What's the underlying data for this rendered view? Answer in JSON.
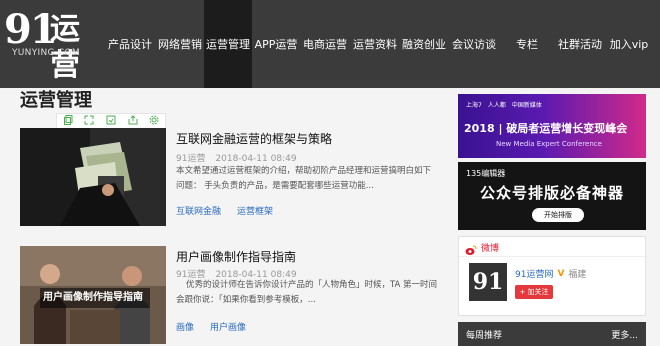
{
  "brand": {
    "number": "91",
    "cn": "运营",
    "en": "YUNYING.COM"
  },
  "nav": [
    {
      "label": "产品设计",
      "active": false
    },
    {
      "label": "网络营销",
      "active": false
    },
    {
      "label": "运营管理",
      "active": true
    },
    {
      "label": "APP运营",
      "active": false
    },
    {
      "label": "电商运营",
      "active": false
    },
    {
      "label": "运营资料",
      "active": false
    },
    {
      "label": "融资创业",
      "active": false
    },
    {
      "label": "会议访谈",
      "active": false
    },
    {
      "label": "专栏",
      "active": false
    },
    {
      "label": "社群活动",
      "active": false
    },
    {
      "label": "加入vip",
      "active": false
    }
  ],
  "page_title": "运营管理",
  "toolbar": {
    "icons": [
      "copy-icon",
      "fullscreen-icon",
      "save-icon",
      "share-icon",
      "settings-icon"
    ]
  },
  "articles": [
    {
      "title": "互联网金融运营的框架与策略",
      "source": "91运营",
      "date": "2018-04-11 08:49",
      "desc": "本文希望通过运营框架的介绍，帮助初阶产品经理和运营搞明白如下问题：   手头负责的产品，是需要配套哪些运营功能...",
      "tags": [
        "互联网金融",
        "运营框架"
      ]
    },
    {
      "title": "用户画像制作指导指南",
      "source": "91运营",
      "date": "2018-04-11 08:49",
      "desc": "优秀的设计师在告诉你设计产品的「人物角色」时候，TA 第一时间会跟你说：「如果你看到参考模板，...",
      "tags": [
        "画像",
        "用户画像"
      ],
      "thumb_caption": "用户画像制作指导指南"
    }
  ],
  "ad1": {
    "logos": [
      "上海7",
      "人人都",
      "中国新媒体"
    ],
    "year": "2018",
    "title": "破局者运营增长变现峰会",
    "subtitle": "New Media Expert Conference"
  },
  "ad2": {
    "badge": "135编辑器",
    "title": "公众号排版必备神器",
    "button": "开始排版"
  },
  "weibo": {
    "header": "微博",
    "logo": "91",
    "name": "91运营网",
    "verified": "V",
    "location": "福建",
    "follow": "+ 加关注"
  },
  "weekly": {
    "title": "每周推荐",
    "more": "更多..."
  },
  "colors": {
    "topbar": "#3b3b3b",
    "nav_active": "#1c1c1c",
    "link": "#2a6bbf",
    "follow_btn": "#e4393c",
    "tool_green": "#4caf50"
  }
}
